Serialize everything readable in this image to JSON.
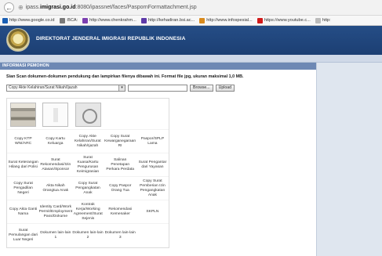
{
  "browser": {
    "back_glyph": "←",
    "url_prefix": "ipass.",
    "url_domain": "imigrasi.go.id",
    "url_suffix": ":8080/ipassnet/faces/PaspornFormattachment.jsp",
    "bookmarks": [
      {
        "label": "http://www.google.co.id",
        "icon": "blue-square-icon",
        "color": "#1a5fb4"
      },
      {
        "label": ":BCA:",
        "icon": "bank-icon",
        "color": "#7a7a7a"
      },
      {
        "label": "http://www.chenkrahm...",
        "icon": "purple-square-icon",
        "color": "#7b3fb0"
      },
      {
        "label": "http://kehadiran.bsi.ac...",
        "icon": "purple-square-icon",
        "color": "#5d3aa8"
      },
      {
        "label": "http://www.infospesial...",
        "icon": "tools-icon",
        "color": "#d98a1c"
      },
      {
        "label": "https://www.youtube.c...",
        "icon": "youtube-icon",
        "color": "#d11a1a"
      },
      {
        "label": "http:",
        "icon": "page-icon",
        "color": "#bbbbbb"
      }
    ]
  },
  "site": {
    "title": "DIREKTORAT JENDERAL IMIGRASI REPUBLIK INDONESIA"
  },
  "section": {
    "title": "INFORMASI PEMOHON"
  },
  "upload": {
    "instruction": "Sian Scan dokumen-dokumen pendukung dan lampirkan filenya dibawah ini. Format file jpg, ukuran maksimal 1,0 MB.",
    "select_value": "Copy Akte Kelahiran/Surat Nikah/Ijazah",
    "browse_label": "Browse...",
    "upload_label": "Upload"
  },
  "documents": [
    [
      "Copy KTP WNI/ARC",
      "Copy Kartu Keluarga",
      "Copy Akte Kelahiran/Surat Nikah/Ijazah",
      "Copy Surat Kewarganegaraan RI",
      "Paspor/SPLP Lama"
    ],
    [
      "Surat Keterangan Hilang dari Polisi",
      "Surat Rekomendasi/Izin Atasan/Sponsor",
      "Surat Kuasa/Kartu Pengurusan Keimigrasian",
      "Salinan Penetapan Perkara Perdata",
      "Surat Pengantar dari Yayasan"
    ],
    [
      "Copy Surat Pengadilan Negeri",
      "Akta Nikah Orangtua Anak",
      "Copy Surat Pengangkatan Anak",
      "Copy Paspor Orang Tua",
      "Copy Surat Pemberian Izin Pengangkatan Anak"
    ],
    [
      "Copy Akta Ganti Nama",
      "Identity Card/Work Permit/Employment Pass/Dokume",
      "Kontrak Kerja/Working Agreement/Surat Sejenis",
      "Rekomendasi Kemenaker",
      "SKPLN"
    ],
    [
      "Surat Pemulangan dari Luar Negeri",
      "Dokumen lain-lain 1",
      "Dokumen lain-lain 2",
      "Dokumen lain-lain 3",
      ""
    ]
  ]
}
